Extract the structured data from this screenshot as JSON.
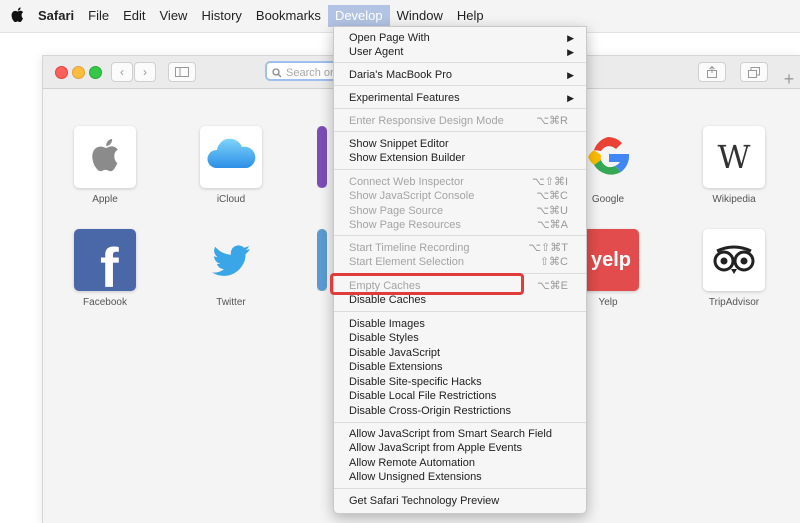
{
  "menubar": {
    "apple_icon": "apple-icon",
    "items": [
      "Safari",
      "File",
      "Edit",
      "View",
      "History",
      "Bookmarks",
      "Develop",
      "Window",
      "Help"
    ],
    "active": "Develop"
  },
  "browser": {
    "address_placeholder": "Search or",
    "favorites": [
      "Apple",
      "iCloud",
      "Google",
      "Wikipedia",
      "Facebook",
      "Twitter",
      "Yelp",
      "TripAdvisor"
    ],
    "tile_texts": {
      "wikipedia": "W",
      "facebook": "f",
      "yelp": "yelp"
    }
  },
  "develop_menu": {
    "open_page_with": "Open Page With",
    "user_agent": "User Agent",
    "device": "Daria's MacBook Pro",
    "experimental": "Experimental Features",
    "responsive": {
      "label": "Enter Responsive Design Mode",
      "shortcut": "⌥⌘R"
    },
    "snippet_editor": "Show Snippet Editor",
    "extension_builder": "Show Extension Builder",
    "web_inspector": {
      "label": "Connect Web Inspector",
      "shortcut": "⌥⇧⌘I"
    },
    "js_console": {
      "label": "Show JavaScript Console",
      "shortcut": "⌥⌘C"
    },
    "page_source": {
      "label": "Show Page Source",
      "shortcut": "⌥⌘U"
    },
    "page_resources": {
      "label": "Show Page Resources",
      "shortcut": "⌥⌘A"
    },
    "timeline": {
      "label": "Start Timeline Recording",
      "shortcut": "⌥⇧⌘T"
    },
    "element_selection": {
      "label": "Start Element Selection",
      "shortcut": "⇧⌘C"
    },
    "empty_caches": {
      "label": "Empty Caches",
      "shortcut": "⌥⌘E"
    },
    "disable_caches": "Disable Caches",
    "disable_images": "Disable Images",
    "disable_styles": "Disable Styles",
    "disable_javascript": "Disable JavaScript",
    "disable_extensions": "Disable Extensions",
    "disable_site_hacks": "Disable Site-specific Hacks",
    "disable_local_file": "Disable Local File Restrictions",
    "disable_cross_origin": "Disable Cross-Origin Restrictions",
    "allow_js_search": "Allow JavaScript from Smart Search Field",
    "allow_js_apple_events": "Allow JavaScript from Apple Events",
    "allow_remote_automation": "Allow Remote Automation",
    "allow_unsigned": "Allow Unsigned Extensions",
    "technology_preview": "Get Safari Technology Preview"
  },
  "colors": {
    "highlight": "#e03c3c",
    "active_menu": "#b3c3e4"
  }
}
